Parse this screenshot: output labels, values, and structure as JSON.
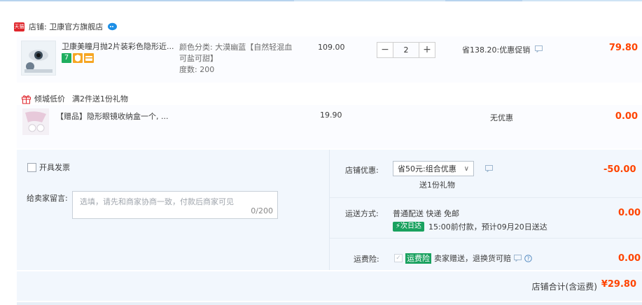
{
  "shop": {
    "badge": "天猫",
    "name": "店铺: 卫康官方旗舰店"
  },
  "item": {
    "title": "卫康美瞳月抛2片装彩色隐形近...",
    "badges": [
      "7",
      "",
      ""
    ],
    "sku_lines": [
      "颜色分类: 大漠幽蓝【自然轻混血",
      "可盐可甜】",
      "度数: 200"
    ],
    "price": "109.00",
    "qty_minus": "−",
    "qty_value": "2",
    "qty_plus": "+",
    "promo": "省138.20:优惠促销",
    "amount": "79.80"
  },
  "gift_promo": {
    "label": "倾城低价",
    "text": "满2件送1份礼物"
  },
  "gift_item": {
    "title": "【赠品】隐形眼镜收纳盒一个, ...",
    "price": "19.90",
    "promo": "无优惠",
    "amount": "0.00"
  },
  "order": {
    "invoice_label": "开具发票",
    "message_label": "给卖家留言:",
    "message_placeholder": "选填，请先和商家协商一致，付款后商家可见",
    "message_count": "0/200",
    "shop_discount_label": "店铺优惠:",
    "shop_discount_value": "省50元:组合优惠",
    "shop_discount_sub": "送1份礼物",
    "shop_discount_amount": "-50.00",
    "shipping_label": "运送方式:",
    "shipping_value": "普通配送 快递 免邮",
    "next_day_tag": "次日达",
    "shipping_eta": "15:00前付款，预计09月20日送达",
    "shipping_amount": "0.00",
    "insurance_label": "运费险:",
    "insurance_tag": "运费险",
    "insurance_text": "卖家赠送，退换货可赔",
    "insurance_amount": "0.00",
    "total_label": "店铺合计(含运费)",
    "total_amount": "¥29.80"
  },
  "colors": {
    "accent": "#ff4400",
    "green": "#19a15f",
    "panel": "#f2f7fd"
  }
}
